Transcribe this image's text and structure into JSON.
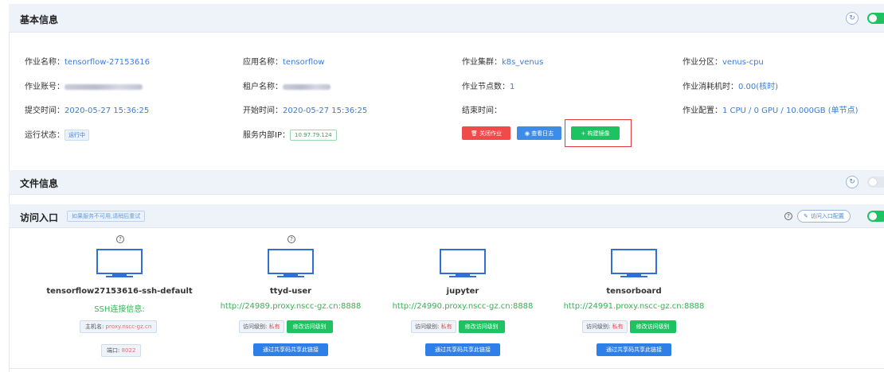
{
  "basic": {
    "title": "基本信息",
    "fields": {
      "job_name_label": "作业名称：",
      "job_name_value": "tensorflow-27153616",
      "app_name_label": "应用名称：",
      "app_name_value": "tensorflow",
      "cluster_label": "作业集群：",
      "cluster_value": "k8s_venus",
      "partition_label": "作业分区：",
      "partition_value": "venus-cpu",
      "account_label": "作业账号：",
      "tenant_label": "租户名称：",
      "nodes_label": "作业节点数：",
      "nodes_value": "1",
      "core_hours_label": "作业消耗机时：",
      "core_hours_value": "0.00(核时)",
      "submit_label": "提交时间：",
      "submit_value": "2020-05-27 15:36:25",
      "start_label": "开始时间：",
      "start_value": "2020-05-27 15:36:25",
      "end_label": "结束时间：",
      "config_label": "作业配置：",
      "config_value": "1 CPU / 0 GPU / 10.000GB (单节点)",
      "status_label": "运行状态：",
      "status_value": "运行中",
      "ip_label": "服务内部IP：",
      "ip_value": "10.97.79.124"
    },
    "actions": {
      "close_job": "关闭作业",
      "view_log": "查看日志",
      "build_image": "构建镜像"
    }
  },
  "files": {
    "title": "文件信息"
  },
  "access": {
    "title": "访问入口",
    "hint": "如果服务不可用,请稍后重试",
    "config_button": "访问入口配置",
    "services": [
      {
        "name": "tensorflow27153616-ssh-default",
        "ssh_title": "SSH连接信息:",
        "host_label": "主机名:",
        "host_value": "proxy.nscc-gz.cn",
        "port_label": "端口:",
        "port_value": "8022"
      },
      {
        "name": "ttyd-user",
        "url": "http://24989.proxy.nscc-gz.cn:8888",
        "level_label": "访问级别:",
        "level_value": "私有",
        "modify_label": "修改访问级别",
        "share_label": "通过共享码共享此链接"
      },
      {
        "name": "jupyter",
        "url": "http://24990.proxy.nscc-gz.cn:8888",
        "level_label": "访问级别:",
        "level_value": "私有",
        "modify_label": "修改访问级别",
        "share_label": "通过共享码共享此链接"
      },
      {
        "name": "tensorboard",
        "url": "http://24991.proxy.nscc-gz.cn:8888",
        "level_label": "访问级别:",
        "level_value": "私有",
        "modify_label": "修改访问级别",
        "share_label": "通过共享码共享此链接"
      }
    ]
  },
  "colors": {
    "accent_blue": "#3d7bd9",
    "success_green": "#1ec361",
    "danger_red": "#f04b4b",
    "highlight_red": "#e23a3a"
  }
}
